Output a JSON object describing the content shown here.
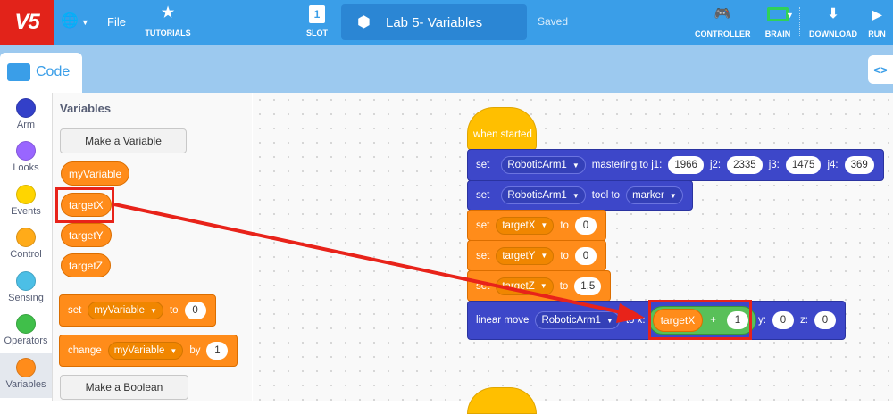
{
  "topbar": {
    "logo": "V5",
    "file_label": "File",
    "tutorials_label": "TUTORIALS",
    "slot_label": "SLOT",
    "slot_number": "1",
    "project_name": "Lab 5- Variables",
    "save_status": "Saved",
    "controller_label": "CONTROLLER",
    "brain_label": "BRAIN",
    "download_label": "DOWNLOAD",
    "run_label": "RUN"
  },
  "code_tab": {
    "label": "Code"
  },
  "toggle_label": "<>",
  "categories": [
    {
      "label": "Arm",
      "color": "#3340c9"
    },
    {
      "label": "Looks",
      "color": "#9966ff"
    },
    {
      "label": "Events",
      "color": "#ffd500"
    },
    {
      "label": "Control",
      "color": "#ffab19"
    },
    {
      "label": "Sensing",
      "color": "#4cbfe6"
    },
    {
      "label": "Operators",
      "color": "#40bf4a"
    },
    {
      "label": "Variables",
      "color": "#ff8c1a"
    }
  ],
  "palette": {
    "heading": "Variables",
    "make_variable": "Make a Variable",
    "variables": [
      "myVariable",
      "targetX",
      "targetY",
      "targetZ"
    ],
    "set_block": {
      "kw": "set",
      "var": "myVariable",
      "to": "to",
      "value": "0"
    },
    "change_block": {
      "kw": "change",
      "var": "myVariable",
      "by": "by",
      "value": "1"
    },
    "make_boolean": "Make a Boolean"
  },
  "workspace": {
    "hat": "when started",
    "mastering": {
      "kw": "set",
      "device": "RoboticArm1",
      "text": "mastering to j1:",
      "j1": "1966",
      "j2_label": "j2:",
      "j2": "2335",
      "j3_label": "j3:",
      "j3": "1475",
      "j4_label": "j4:",
      "j4": "369"
    },
    "tool": {
      "kw": "set",
      "device": "RoboticArm1",
      "text": "tool to",
      "tool": "marker"
    },
    "set_x": {
      "kw": "set",
      "var": "targetX",
      "to": "to",
      "value": "0"
    },
    "set_y": {
      "kw": "set",
      "var": "targetY",
      "to": "to",
      "value": "0"
    },
    "set_z": {
      "kw": "set",
      "var": "targetZ",
      "to": "to",
      "value": "1.5"
    },
    "move": {
      "kw": "linear move",
      "device": "RoboticArm1",
      "x_label": "to x:",
      "x_var": "targetX",
      "op": "+",
      "x_add": "1",
      "y_label": "y:",
      "y": "0",
      "z_label": "z:",
      "z": "0"
    }
  },
  "colors": {
    "annotation": "#e8231a",
    "variables": "#ff8c1a",
    "arm": "#3d47c9",
    "events": "#ffbf00",
    "operators": "#59c059"
  }
}
